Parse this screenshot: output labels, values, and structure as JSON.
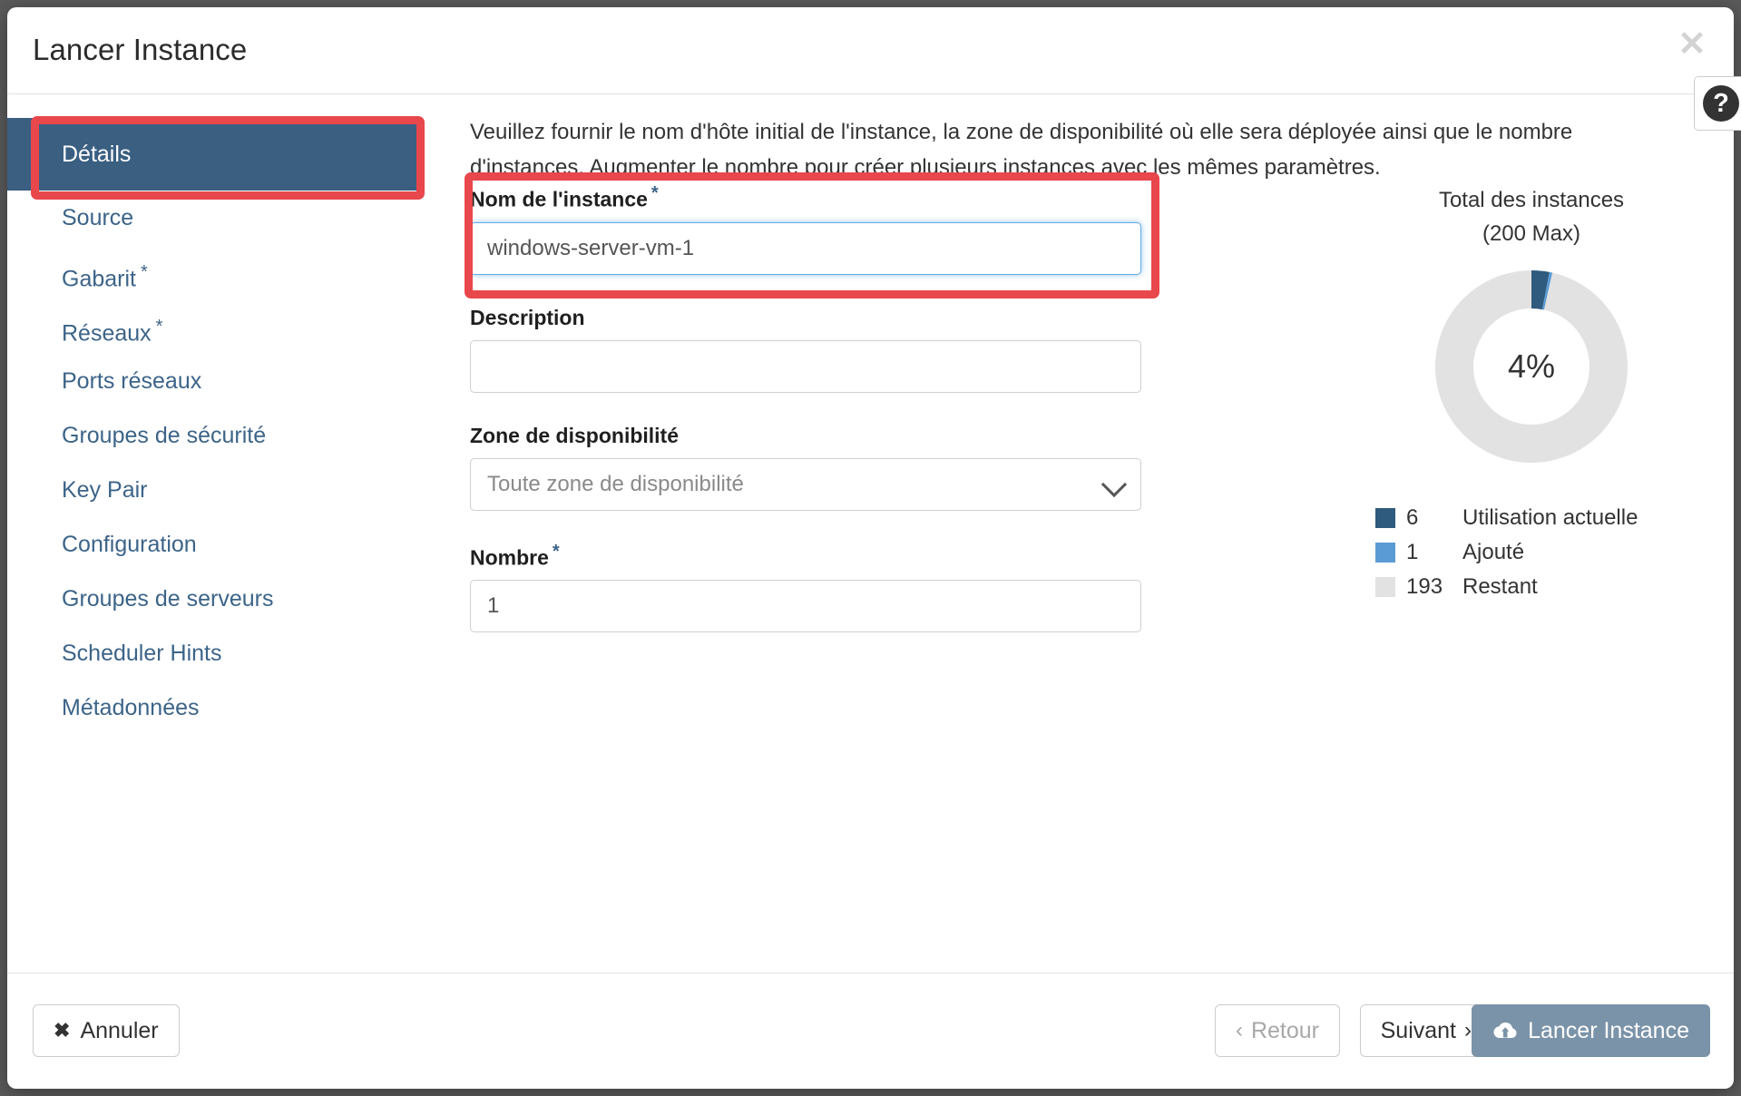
{
  "window": {
    "title": "Lancer Instance",
    "close_icon": "close-icon",
    "help_icon": "help-question-icon",
    "help_label": "?"
  },
  "sidebar": {
    "items": [
      {
        "label": "Détails",
        "required": false,
        "active": true
      },
      {
        "label": "Source",
        "required": false,
        "active": false
      },
      {
        "label": "Gabarit",
        "required": true,
        "active": false
      },
      {
        "label": "Réseaux",
        "required": true,
        "active": false
      },
      {
        "label": "Ports réseaux",
        "required": false,
        "active": false
      },
      {
        "label": "Groupes de sécurité",
        "required": false,
        "active": false
      },
      {
        "label": "Key Pair",
        "required": false,
        "active": false
      },
      {
        "label": "Configuration",
        "required": false,
        "active": false
      },
      {
        "label": "Groupes de serveurs",
        "required": false,
        "active": false
      },
      {
        "label": "Scheduler Hints",
        "required": false,
        "active": false
      },
      {
        "label": "Métadonnées",
        "required": false,
        "active": false
      }
    ]
  },
  "main": {
    "intro": "Veuillez fournir le nom d'hôte initial de l'instance, la zone de disponibilité où elle sera déployée ainsi que le nombre d'instances. Augmenter le nombre pour créer plusieurs instances avec les mêmes paramètres.",
    "fields": {
      "instance_name": {
        "label": "Nom de l'instance",
        "required_marker": "*",
        "value": "windows-server-vm-1",
        "placeholder": ""
      },
      "description": {
        "label": "Description",
        "value": "",
        "placeholder": ""
      },
      "availability_zone": {
        "label": "Zone de disponibilité",
        "value": "Toute zone de disponibilité",
        "chevron_icon": "chevron-down-icon"
      },
      "count": {
        "label": "Nombre",
        "required_marker": "*",
        "value": "1",
        "placeholder": ""
      }
    }
  },
  "chart_data": {
    "type": "pie",
    "title": "Total des instances",
    "subtitle": "(200 Max)",
    "center_label": "4%",
    "max": 200,
    "categories": [
      "Utilisation actuelle",
      "Ajouté",
      "Restant"
    ],
    "values": [
      6,
      1,
      193
    ],
    "colors": [
      "#2f5b7e",
      "#5b9bd5",
      "#e2e2e2"
    ],
    "legend": [
      {
        "value": "6",
        "label": "Utilisation actuelle",
        "color": "#2f5b7e"
      },
      {
        "value": "1",
        "label": "Ajouté",
        "color": "#5b9bd5"
      },
      {
        "value": "193",
        "label": "Restant",
        "color": "#e2e2e2"
      }
    ],
    "legend_position": "bottom",
    "grid": false
  },
  "footer": {
    "cancel": {
      "label": "Annuler",
      "icon": "x-icon"
    },
    "back": {
      "label": "Retour",
      "icon": "chevron-left-icon"
    },
    "next": {
      "label": "Suivant",
      "icon": "chevron-right-icon"
    },
    "launch": {
      "label": "Lancer Instance",
      "icon": "cloud-upload-icon"
    }
  },
  "colors": {
    "accent_blue": "#3a5f81",
    "highlight_red": "#e8474c",
    "link_blue": "#3c6488",
    "launch_btn": "#7b93a8"
  }
}
